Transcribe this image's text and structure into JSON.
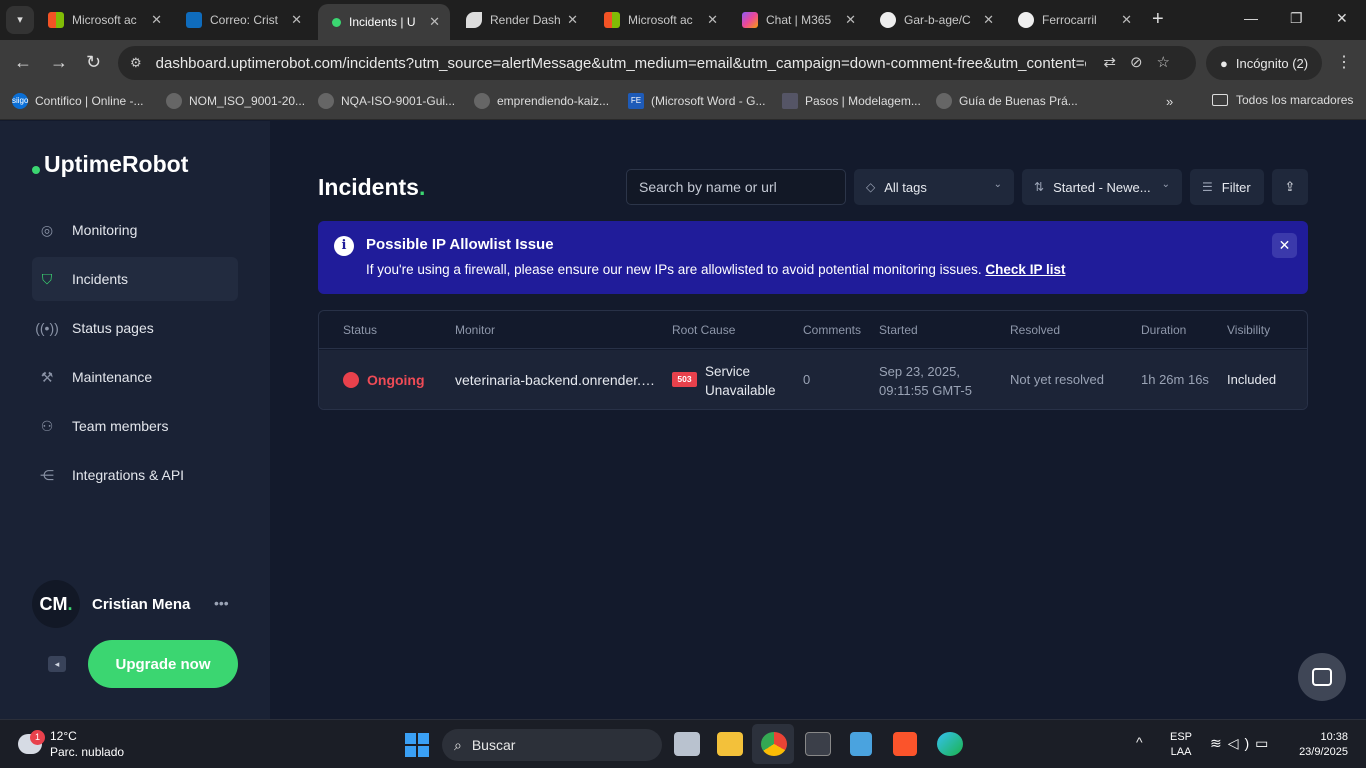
{
  "browser": {
    "tabs": [
      {
        "title": "Microsoft ac",
        "active": false
      },
      {
        "title": "Correo: Crist",
        "active": false
      },
      {
        "title": "Incidents | U",
        "active": true
      },
      {
        "title": "Render Dash",
        "active": false
      },
      {
        "title": "Microsoft ac",
        "active": false
      },
      {
        "title": "Chat | M365",
        "active": false
      },
      {
        "title": "Gar-b-age/C",
        "active": false
      },
      {
        "title": "Ferrocarril",
        "active": false
      }
    ],
    "url": "dashboard.uptimerobot.com/incidents?utm_source=alertMessage&utm_medium=email&utm_campaign=down-comment-free&utm_content=comm...",
    "incognito_label": "Incógnito (2)",
    "bookmarks": [
      "Contifico | Online -...",
      "NOM_ISO_9001-20...",
      "NQA-ISO-9001-Gui...",
      "emprendiendo-kaiz...",
      "(Microsoft Word - G...",
      "Pasos | Modelagem...",
      "Guía de Buenas Prá..."
    ],
    "bookmark_icon_labels": [
      "siigo",
      "",
      "",
      "",
      "FE",
      "",
      ""
    ],
    "all_bookmarks": "Todos los marcadores"
  },
  "sidebar": {
    "brand": "UptimeRobot",
    "items": [
      {
        "label": "Monitoring",
        "icon": "monitoring-icon",
        "active": false
      },
      {
        "label": "Incidents",
        "icon": "shield-icon",
        "active": true
      },
      {
        "label": "Status pages",
        "icon": "broadcast-icon",
        "active": false
      },
      {
        "label": "Maintenance",
        "icon": "wrench-icon",
        "active": false
      },
      {
        "label": "Team members",
        "icon": "user-icon",
        "active": false
      },
      {
        "label": "Integrations & API",
        "icon": "share-icon",
        "active": false
      }
    ],
    "user": {
      "initials": "CM",
      "name": "Cristian Mena"
    },
    "upgrade_label": "Upgrade now"
  },
  "main": {
    "title": "Incidents",
    "search_placeholder": "Search by name or url",
    "tags_label": "All tags",
    "sort_label": "Started - Newe...",
    "filter_label": "Filter"
  },
  "alert": {
    "title": "Possible IP Allowlist Issue",
    "body": "If you're using a firewall, please ensure our new IPs are allowlisted to avoid potential monitoring issues.",
    "link": "Check IP list"
  },
  "table": {
    "headers": [
      "Status",
      "Monitor",
      "Root Cause",
      "Comments",
      "Started",
      "Resolved",
      "Duration",
      "Visibility"
    ],
    "rows": [
      {
        "status": "Ongoing",
        "monitor": "veterinaria-backend.onrender.c...",
        "cause_code": "503",
        "cause_line1": "Service",
        "cause_line2": "Unavailable",
        "comments": "0",
        "started_line1": "Sep 23, 2025,",
        "started_line2": "09:11:55 GMT-5",
        "resolved": "Not yet resolved",
        "duration": "1h 26m 16s",
        "visibility": "Included"
      }
    ]
  },
  "taskbar": {
    "weather_temp": "12°C",
    "weather_desc": "Parc. nublado",
    "weather_badge": "1",
    "search_label": "Buscar",
    "lang_line1": "ESP",
    "lang_line2": "LAA",
    "time": "10:38",
    "date": "23/9/2025"
  },
  "colors": {
    "accent": "#3bd671",
    "alert_bg": "#201c9a",
    "danger": "#e8414c",
    "sidebar_bg": "#1a2235",
    "main_bg": "#131a2c"
  }
}
